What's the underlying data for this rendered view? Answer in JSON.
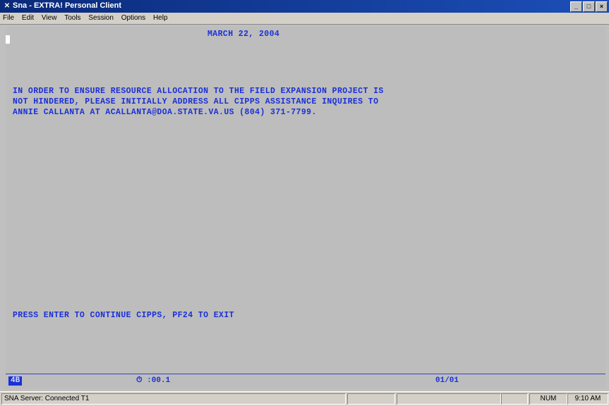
{
  "window": {
    "title": "Sna - EXTRA! Personal Client",
    "icon": "extra-app-icon",
    "buttons": [
      "minimize",
      "maximize",
      "close"
    ]
  },
  "menu": [
    "File",
    "Edit",
    "View",
    "Tools",
    "Session",
    "Options",
    "Help"
  ],
  "screen": {
    "date": "MARCH 22, 2004",
    "message_lines": [
      "IN ORDER TO ENSURE RESOURCE ALLOCATION TO THE FIELD EXPANSION PROJECT IS",
      "NOT HINDERED, PLEASE INITIALLY ADDRESS ALL CIPPS ASSISTANCE INQUIRES TO",
      "ANNIE CALLANTA AT ACALLANTA@DOA.STATE.VA.US (804) 371-7799."
    ],
    "prompt": "PRESS ENTER TO CONTINUE CIPPS, PF24 TO EXIT"
  },
  "oia": {
    "indicator": "4B",
    "clock": "⏱ :00.1",
    "position": "01/01"
  },
  "status": {
    "connection": "SNA Server: Connected T1",
    "num": "NUM",
    "time": "9:10 AM"
  },
  "colors": {
    "screen_text": "#1a30d8",
    "screen_bg": "#bdbdbd",
    "titlebar": "#0a2a7a"
  }
}
